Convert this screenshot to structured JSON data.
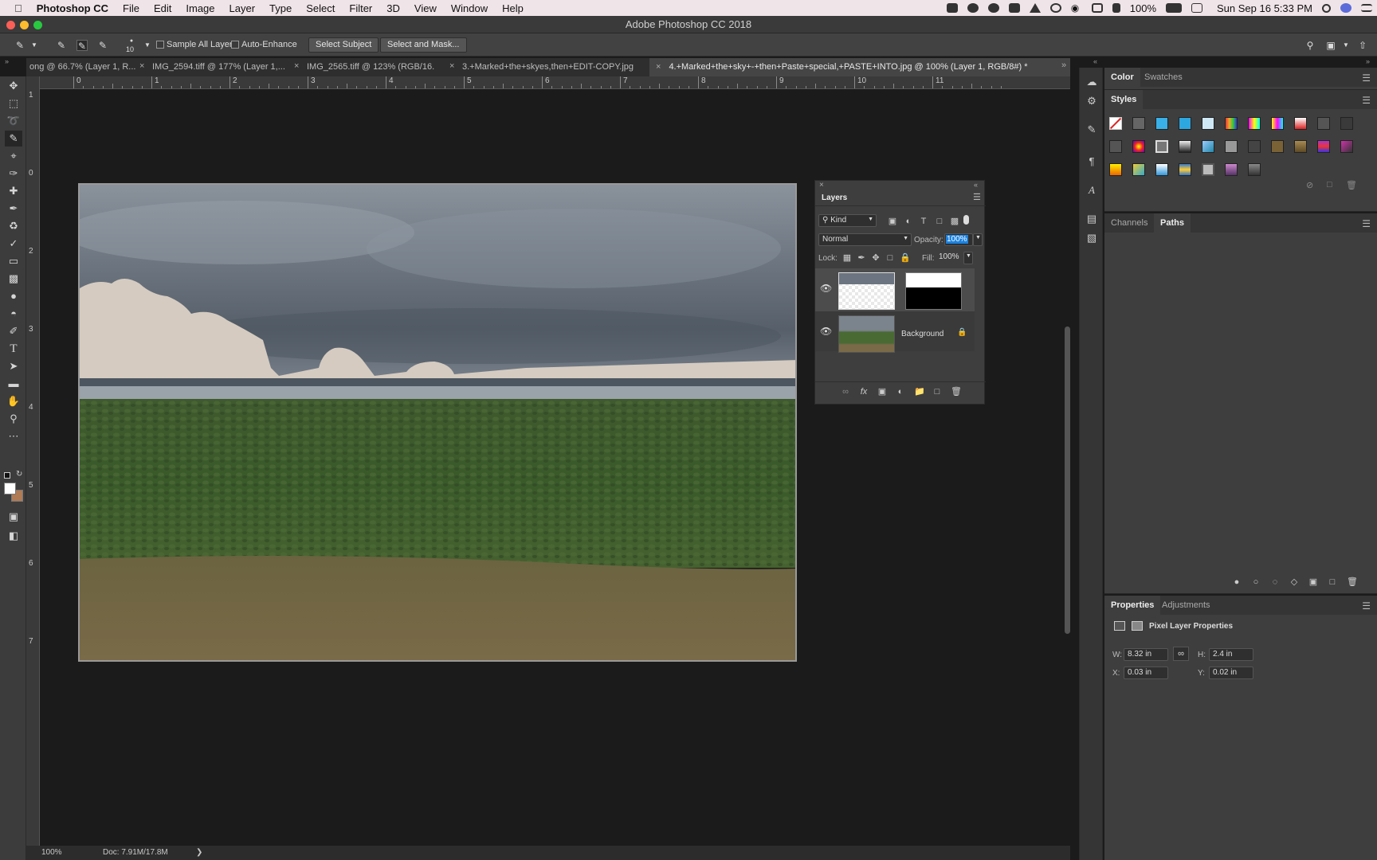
{
  "menubar": {
    "app": "Photoshop CC",
    "items": [
      "File",
      "Edit",
      "Image",
      "Layer",
      "Type",
      "Select",
      "Filter",
      "3D",
      "View",
      "Window",
      "Help"
    ],
    "battery": "100%",
    "datetime": "Sun Sep 16  5:33 PM"
  },
  "window": {
    "title": "Adobe Photoshop CC 2018"
  },
  "options": {
    "brush_size": "10",
    "sample_all_layers": "Sample All Layers",
    "auto_enhance": "Auto-Enhance",
    "select_subject": "Select Subject",
    "select_and_mask": "Select and Mask..."
  },
  "tabs": [
    "ong @ 66.7% (Layer 1, R...",
    "IMG_2594.tiff @ 177% (Layer 1,...",
    "IMG_2565.tiff @ 123% (RGB/16...",
    "3.+Marked+the+skyes,then+EDIT-COPY.jpg",
    "4.+Marked+the+sky+-+then+Paste+special,+PASTE+INTO.jpg @ 100% (Layer 1, RGB/8#) *"
  ],
  "ruler_h": [
    "0",
    "1",
    "2",
    "3",
    "4",
    "5",
    "6",
    "7",
    "8",
    "9",
    "10",
    "11"
  ],
  "ruler_v": [
    "1",
    "0",
    "2",
    "3",
    "4",
    "5",
    "6",
    "7"
  ],
  "status": {
    "zoom": "100%",
    "doc": "Doc: 7.91M/17.8M",
    "arrow": "❯"
  },
  "layers_panel": {
    "title": "Layers",
    "kind": "Kind",
    "blend_mode": "Normal",
    "opacity_label": "Opacity:",
    "opacity_value": "100%",
    "lock_label": "Lock:",
    "fill_label": "Fill:",
    "fill_value": "100%",
    "layers": [
      {
        "name": "",
        "visible": true,
        "has_mask": true
      },
      {
        "name": "Background",
        "visible": true,
        "locked": true
      }
    ]
  },
  "color_panel": {
    "tabs": [
      "Color",
      "Swatches"
    ]
  },
  "styles_panel": {
    "title": "Styles"
  },
  "channels_panel": {
    "tabs": [
      "Channels",
      "Paths"
    ]
  },
  "properties_panel": {
    "tabs": [
      "Properties",
      "Adjustments"
    ],
    "heading": "Pixel Layer Properties",
    "w_label": "W:",
    "w_value": "8.32 in",
    "h_label": "H:",
    "h_value": "2.4 in",
    "x_label": "X:",
    "x_value": "0.03 in",
    "y_label": "Y:",
    "y_value": "0.02 in"
  },
  "colors": {
    "accent": "#1a82e2",
    "foreground": "#ffffff",
    "background": "#b07b55"
  }
}
